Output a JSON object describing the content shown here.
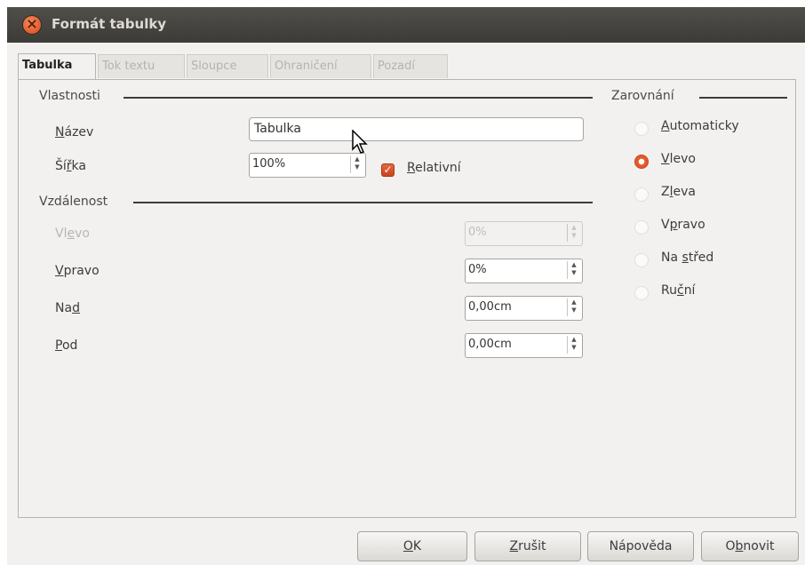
{
  "window": {
    "title": "Formát tabulky"
  },
  "tabs": [
    {
      "label": "Tabulka",
      "active": true
    },
    {
      "label": "Tok textu",
      "active": false
    },
    {
      "label": "Sloupce",
      "active": false
    },
    {
      "label": "Ohraničení",
      "active": false
    },
    {
      "label": "Pozadí",
      "active": false
    }
  ],
  "properties": {
    "heading": "Vlastnosti",
    "name_label": {
      "before": "",
      "key": "N",
      "after": "ázev"
    },
    "name_value": "Tabulka",
    "width_label": {
      "before": "Ší",
      "key": "ř",
      "after": "ka"
    },
    "width_value": "100%",
    "relative_label": {
      "before": "",
      "key": "R",
      "after": "elativní"
    },
    "relative_checked": true
  },
  "spacing": {
    "heading": "Vzdálenost",
    "left_label": {
      "before": "Vl",
      "key": "e",
      "after": "vo"
    },
    "left_value": "0%",
    "right_label": {
      "before": "",
      "key": "V",
      "after": "pravo"
    },
    "right_value": "0%",
    "above_label": {
      "before": "Na",
      "key": "d",
      "after": ""
    },
    "above_value": "0,00cm",
    "below_label": {
      "before": "",
      "key": "P",
      "after": "od"
    },
    "below_value": "0,00cm"
  },
  "alignment": {
    "heading": "Zarovnání",
    "options": [
      {
        "before": "",
        "key": "A",
        "after": "utomaticky",
        "checked": false
      },
      {
        "before": "",
        "key": "V",
        "after": "levo",
        "checked": true
      },
      {
        "before": "Z",
        "key": "l",
        "after": "eva",
        "checked": false
      },
      {
        "before": "V",
        "key": "p",
        "after": "ravo",
        "checked": false
      },
      {
        "before": "Na ",
        "key": "s",
        "after": "třed",
        "checked": false
      },
      {
        "before": "Ru",
        "key": "č",
        "after": "ní",
        "checked": false
      }
    ]
  },
  "buttons": {
    "ok": {
      "before": "",
      "key": "O",
      "after": "K"
    },
    "cancel": {
      "before": "",
      "key": "Z",
      "after": "rušit"
    },
    "help": "Nápověda",
    "reset": {
      "before": "O",
      "key": "b",
      "after": "novit"
    }
  },
  "colors": {
    "accent": "#e0562a",
    "titlebar": "#3c3b37",
    "background": "#f2f1f0"
  }
}
